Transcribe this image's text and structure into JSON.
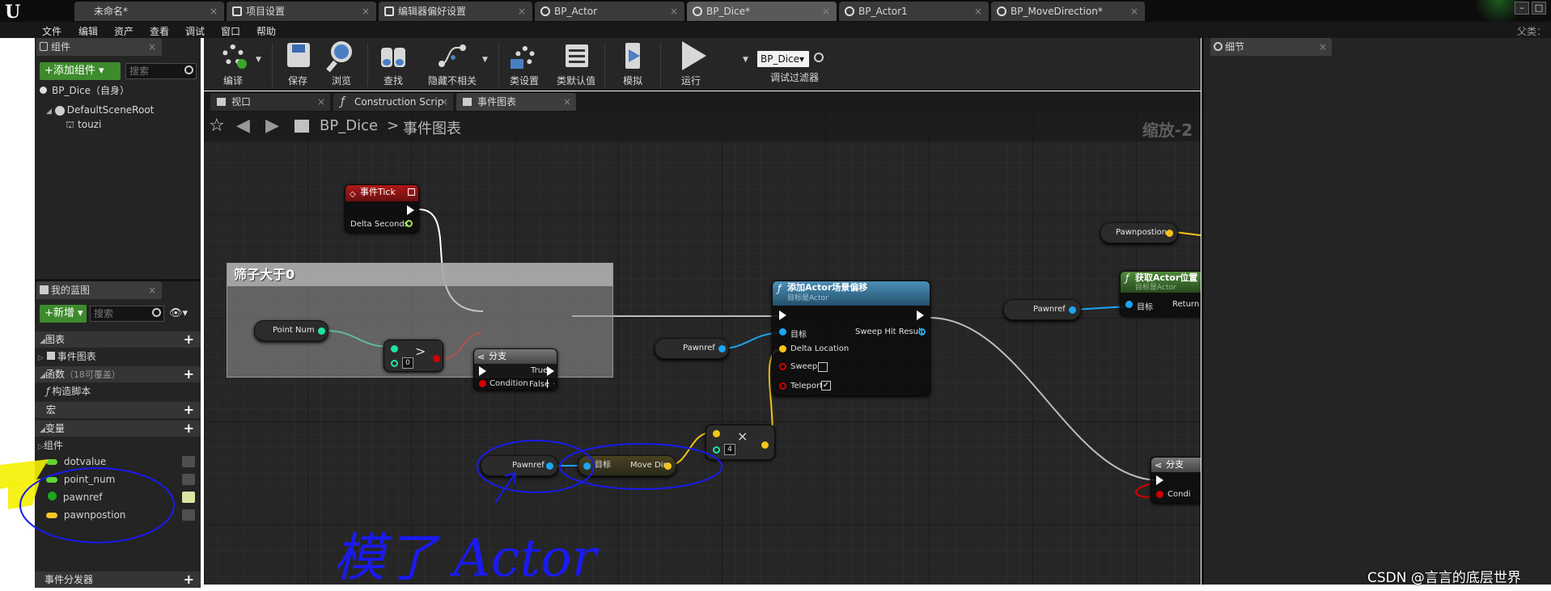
{
  "tabs": [
    {
      "label": "未命名*"
    },
    {
      "label": "项目设置"
    },
    {
      "label": "编辑器偏好设置"
    },
    {
      "label": "BP_Actor"
    },
    {
      "label": "BP_Dice*"
    },
    {
      "label": "BP_Actor1"
    },
    {
      "label": "BP_MoveDirection*"
    }
  ],
  "menu": {
    "items": [
      "文件",
      "编辑",
      "资产",
      "查看",
      "调试",
      "窗口",
      "帮助"
    ],
    "parent_class": "父类："
  },
  "components": {
    "tab_label": "组件",
    "add_button": "+添加组件 ▾",
    "search_placeholder": "搜索",
    "self_label": "BP_Dice（自身）",
    "root": "DefaultSceneRoot",
    "child": "touzi"
  },
  "my_blueprint": {
    "tab_label": "我的蓝图",
    "new_button": "+新增 ▾",
    "search_placeholder": "搜索",
    "sections": {
      "graphs": "图表",
      "event_graph": "事件图表",
      "functions": "函数",
      "functions_note": "（18可覆盖）",
      "construction_script": "构造脚本",
      "macros": "宏",
      "variables": "变量",
      "components": "组件",
      "event_dispatchers": "事件分发器"
    },
    "variables": [
      {
        "name": "dotvalue",
        "color": "#62d633"
      },
      {
        "name": "point_num",
        "color": "#62d633"
      },
      {
        "name": "pawnref",
        "color": "#1aa91a"
      },
      {
        "name": "pawnpostion",
        "color": "#f7c825"
      }
    ]
  },
  "toolbar": {
    "buttons": [
      {
        "label": "编译"
      },
      {
        "label": "保存"
      },
      {
        "label": "浏览"
      },
      {
        "label": "查找"
      },
      {
        "label": "隐藏不相关"
      },
      {
        "label": "类设置"
      },
      {
        "label": "类默认值"
      },
      {
        "label": "模拟"
      },
      {
        "label": "运行"
      }
    ],
    "debug_object": "BP_Dice▾",
    "debug_filter": "调试过滤器"
  },
  "graph_tabs": [
    {
      "label": "视口"
    },
    {
      "label": "Construction Scrip"
    },
    {
      "label": "事件图表"
    }
  ],
  "graph": {
    "breadcrumb_root": "BP_Dice",
    "breadcrumb_sep": ">",
    "breadcrumb_current": "事件图表",
    "zoom": "缩放-2",
    "comment_title": "筛子大于0",
    "nodes": {
      "event_tick": {
        "title": "事件Tick",
        "pin": "Delta Seconds"
      },
      "point_num": "Point Num",
      "compare_value": "0",
      "branch1": {
        "title": "分支",
        "true": "True",
        "false": "False",
        "condition": "Condition"
      },
      "pawnref1": "Pawnref",
      "add_offset": {
        "title": "添加Actor场景偏移",
        "subtitle": "目标是Actor",
        "target": "目标",
        "delta": "Delta Location",
        "sweep": "Sweep",
        "teleport": "Teleport",
        "sweep_result": "Sweep Hit Result"
      },
      "multiply_value": "4",
      "pawnref2": "Pawnref",
      "move_dir": {
        "target": "目标",
        "output": "Move Dir"
      },
      "pawnpostion": "Pawnpostion",
      "pawnref3": "Pawnref",
      "get_location": {
        "title": "获取Actor位置",
        "subtitle": "目标是Actor",
        "target": "目标",
        "return": "Return V"
      },
      "branch2": {
        "title": "分支",
        "condition": "Condi"
      }
    },
    "annotation_handwriting": "模了 Actor"
  },
  "details": {
    "tab_label": "细节"
  },
  "watermark": "CSDN @言言的底层世界",
  "colors": {
    "accent_green": "#3d8b2c",
    "object_pin": "#1ca6f5",
    "bool_pin": "#d40000",
    "vector_pin": "#f5c518",
    "int_pin": "#1fe3a6",
    "annotation_blue": "#1a1af0",
    "annotation_yellow": "#f5f000"
  }
}
